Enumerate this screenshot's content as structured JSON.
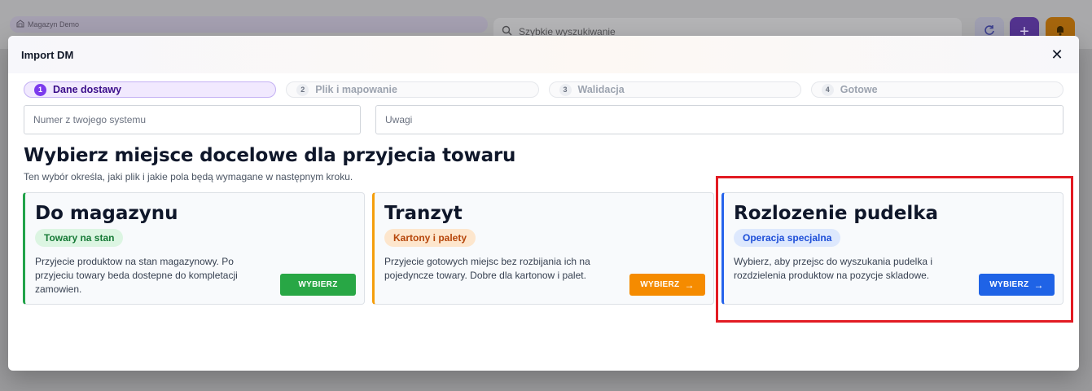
{
  "background": {
    "workspace_label": "Magazyn Demo",
    "search_placeholder": "Szybkie wyszukiwanie",
    "icons": [
      "warehouse-icon",
      "search-icon",
      "refresh-icon",
      "plus-icon",
      "bell-icon"
    ]
  },
  "modal": {
    "title": "Import DM",
    "close_symbol": "✕"
  },
  "steps": [
    {
      "num": "1",
      "label": "Dane dostawy",
      "active": true
    },
    {
      "num": "2",
      "label": "Plik i mapowanie",
      "active": false
    },
    {
      "num": "3",
      "label": "Walidacja",
      "active": false
    },
    {
      "num": "4",
      "label": "Gotowe",
      "active": false
    }
  ],
  "inputs": {
    "system_number_placeholder": "Numer z twojego systemu",
    "notes_placeholder": "Uwagi"
  },
  "section": {
    "title": "Wybierz miejsce docelowe dla przyjecia towaru",
    "subtitle": "Ten wybór określa, jaki plik i jakie pola będą wymagane w następnym kroku."
  },
  "cards": [
    {
      "title": "Do magazynu",
      "badge": "Towary na stan",
      "description": "Przyjecie produktow na stan magazynowy. Po przyjeciu towary beda dostepne do kompletacji zamowien.",
      "button": "WYBIERZ",
      "accent": "#22a34a"
    },
    {
      "title": "Tranzyt",
      "badge": "Kartony i palety",
      "description": "Przyjecie gotowych miejsc bez rozbijania ich na pojedyncze towary. Dobre dla kartonow i palet.",
      "button": "WYBIERZ",
      "accent": "#f59e0b"
    },
    {
      "title": "Rozlozenie pudelka",
      "badge": "Operacja specjalna",
      "description": "Wybierz, aby przejsc do wyszukania pudelka i rozdzielenia produktow na pozycje skladowe.",
      "button": "WYBIERZ",
      "accent": "#2563eb"
    }
  ],
  "colors": {
    "highlight_border": "#e21b23",
    "active_step": "#7c3aed"
  }
}
